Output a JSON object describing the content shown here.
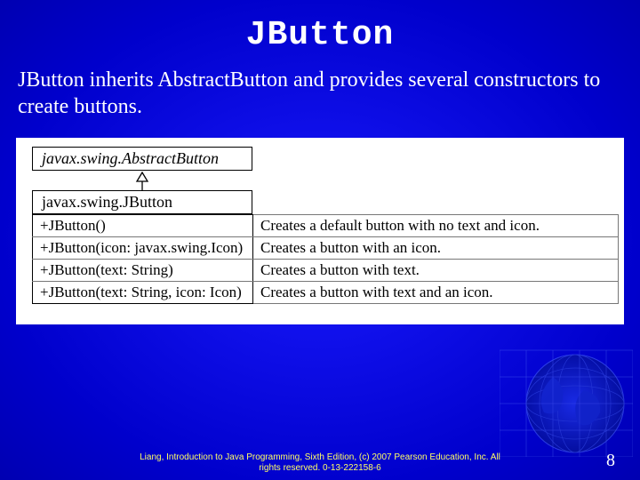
{
  "title": "JButton",
  "subtitle": "JButton inherits AbstractButton and provides several constructors to create buttons.",
  "uml": {
    "superclass": "javax.swing.AbstractButton",
    "subclass": "javax.swing.JButton",
    "rows": [
      {
        "sig": "+JButton()",
        "desc": "Creates a default button with no text and icon."
      },
      {
        "sig": "+JButton(icon: javax.swing.Icon)",
        "desc": "Creates a button with an icon."
      },
      {
        "sig": "+JButton(text: String)",
        "desc": "Creates a button with text."
      },
      {
        "sig": "+JButton(text: String, icon: Icon)",
        "desc": "Creates a button with text and an icon."
      }
    ]
  },
  "footer": {
    "line1": "Liang, Introduction to Java Programming, Sixth Edition, (c) 2007 Pearson Education, Inc. All",
    "line2": "rights reserved. 0-13-222158-6"
  },
  "slide_number": "8"
}
